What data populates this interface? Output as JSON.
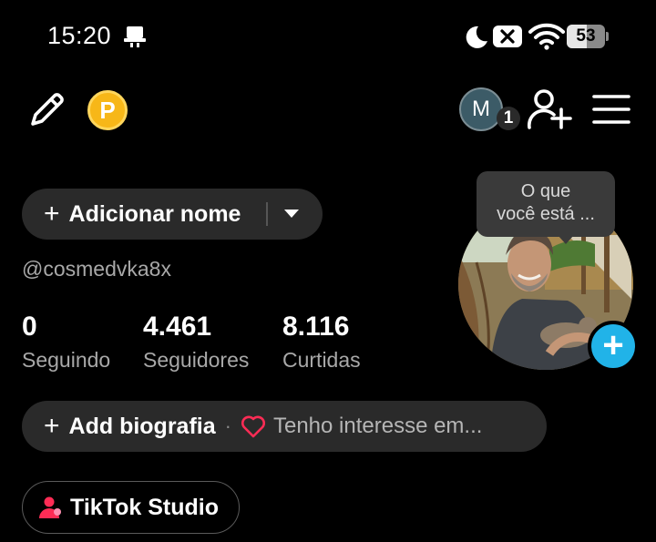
{
  "status_bar": {
    "time": "15:20",
    "battery": "53",
    "battery_level_percent": 53,
    "icons": [
      "notification-icon",
      "moon-icon",
      "mute-icon",
      "wifi-icon",
      "battery-icon"
    ]
  },
  "top_bar": {
    "icons": [
      "edit-pencil-icon",
      "coin-icon",
      "add-friend-icon",
      "menu-icon"
    ],
    "coin_letter": "P",
    "account_initial": "M",
    "account_badge": "1"
  },
  "profile": {
    "add_name_plus": "+",
    "add_name_label": "Adicionar nome",
    "handle": "@cosmedvka8x",
    "photo_tooltip_line1": "O que",
    "photo_tooltip_line2": "você está ...",
    "add_photo_plus": "+"
  },
  "stats": [
    {
      "value": "0",
      "label": "Seguindo"
    },
    {
      "value": "4.461",
      "label": "Seguidores"
    },
    {
      "value": "8.116",
      "label": "Curtidas"
    }
  ],
  "bio": {
    "plus": "+",
    "add_label": "Add biografia",
    "separator": "·",
    "interest_text": "Tenho interesse em..."
  },
  "studio": {
    "label": "TikTok Studio"
  },
  "colors": {
    "background": "#000000",
    "pill": "#2a2a2a",
    "secondary_text": "#a8a8a8",
    "coin": "#f7b718",
    "add_photo": "#21b3e8",
    "heart": "#fe2c55"
  }
}
